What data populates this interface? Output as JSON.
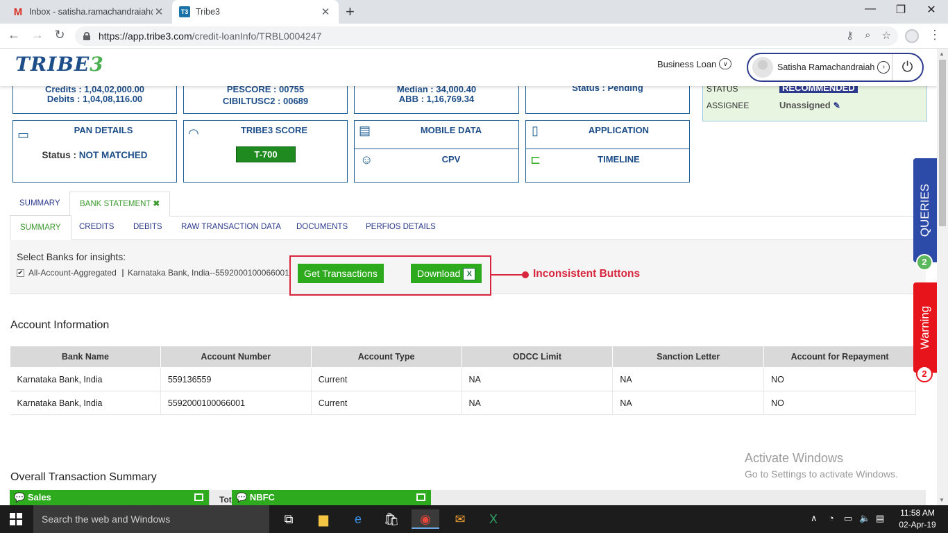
{
  "browser": {
    "tabs": [
      {
        "title": "Inbox - satisha.ramachandraiah@",
        "icon": "gmail-icon"
      },
      {
        "title": "Tribe3",
        "icon": "tribe3-favicon"
      }
    ],
    "url_host": "https://app.tribe3.com",
    "url_path": "/credit-loanInfo/TRBL0004247"
  },
  "header": {
    "logo_main": "TRIBE",
    "logo_suffix": "3",
    "loan_type": "Business Loan",
    "user_name": "Satisha Ramachandraiah"
  },
  "cards_top": {
    "credits_partial": "Credits : 1,04,02,000.00",
    "debits": "Debits : 1,04,08,116.00",
    "pescore_partial": "PESCORE : 00755",
    "cibil": "CIBILTUSC2 : 00689",
    "median_partial": "Median : 34,000.40",
    "abb": "ABB : 1,16,769.34",
    "status_partial": "Status : Pending"
  },
  "status_panel": {
    "status_label": "STATUS",
    "status_value": "RECOMMENDED",
    "assignee_label": "ASSIGNEE",
    "assignee_value": "Unassigned"
  },
  "cards": {
    "pan_title": "PAN DETAILS",
    "pan_status_label": "Status : ",
    "pan_status_value": "NOT MATCHED",
    "score_title": "TRIBE3 SCORE",
    "score_value": "T-700",
    "mobile_title": "MOBILE DATA",
    "cpv_title": "CPV",
    "application_title": "APPLICATION",
    "timeline_title": "TIMELINE"
  },
  "tabs_main": [
    "SUMMARY",
    "BANK STATEMENT"
  ],
  "tabs_sub": [
    "SUMMARY",
    "CREDITS",
    "DEBITS",
    "RAW TRANSACTION DATA",
    "DOCUMENTS",
    "PERFIOS DETAILS"
  ],
  "bank_select": {
    "label": "Select Banks for insights:",
    "option1": "All-Account-Aggregated",
    "option2": "Karnataka Bank, India--5592000100066001",
    "get_btn": "Get Transactions",
    "download_btn": "Download",
    "annotation": "Inconsistent Buttons"
  },
  "account_info": {
    "title": "Account Information",
    "columns": [
      "Bank Name",
      "Account Number",
      "Account Type",
      "ODCC Limit",
      "Sanction Letter",
      "Account for Repayment"
    ],
    "rows": [
      [
        "Karnataka Bank, India",
        "559136559",
        "Current",
        "NA",
        "NA",
        "NO"
      ],
      [
        "Karnataka Bank, India",
        "5592000100066001",
        "Current",
        "NA",
        "NA",
        "NO"
      ]
    ]
  },
  "summary": {
    "title": "Overall Transaction Summary",
    "sales_label": "Sales",
    "nbfc_label": "NBFC",
    "total_partial": "Tot"
  },
  "side_tabs": {
    "queries_label": "QUERIES",
    "queries_count": "2",
    "warning_label": "Warning",
    "warning_count": "2"
  },
  "watermark": {
    "line1": "Activate Windows",
    "line2": "Go to Settings to activate Windows."
  },
  "taskbar": {
    "search_placeholder": "Search the web and Windows",
    "time": "11:58 AM",
    "date": "02-Apr-19"
  },
  "colors": {
    "primary_blue": "#1d4e89",
    "accent_green": "#2eaa1e",
    "annotation_red": "#d7263d",
    "queries_blue": "#2c4aa8",
    "warning_red": "#e8141b"
  }
}
